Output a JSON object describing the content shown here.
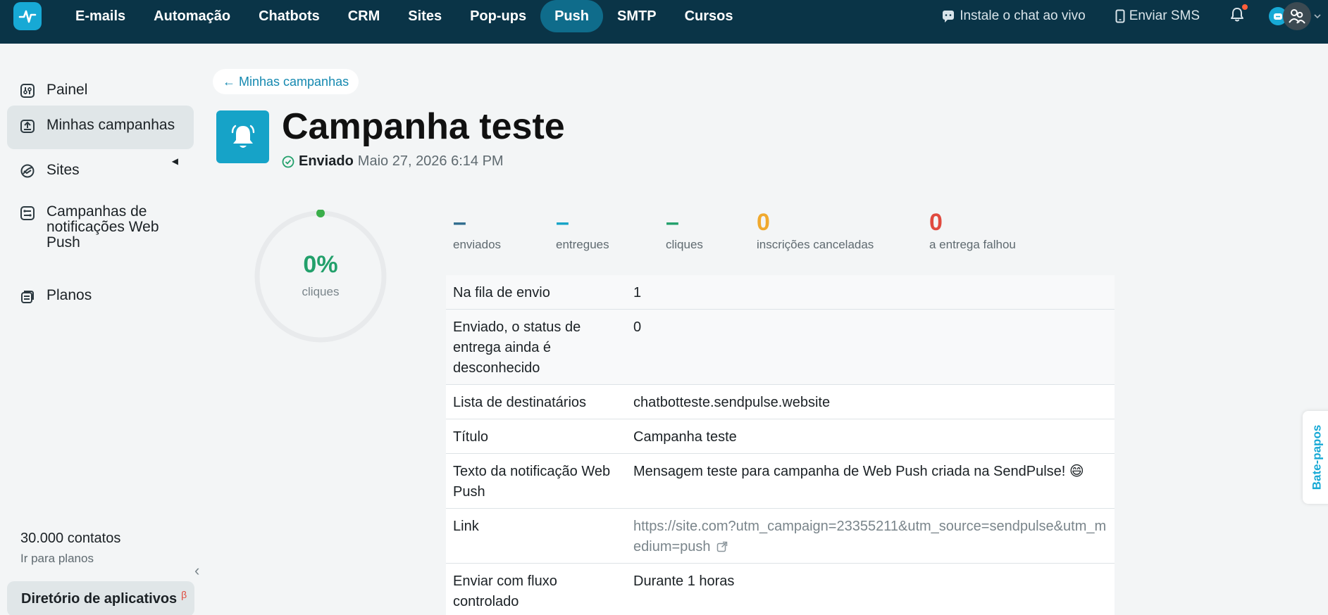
{
  "topbar": {
    "nav": [
      "E-mails",
      "Automação",
      "Chatbots",
      "CRM",
      "Sites",
      "Pop-ups",
      "Push",
      "SMTP",
      "Cursos"
    ],
    "active": "Push",
    "live_chat": "Instale o chat ao vivo",
    "sms": "Enviar SMS"
  },
  "sidebar": {
    "items": [
      {
        "label": "Painel",
        "icon": "dashboard-icon"
      },
      {
        "label": "Minhas campanhas",
        "icon": "campaigns-icon"
      },
      {
        "label": "Sites",
        "icon": "sites-icon"
      },
      {
        "label": "Campanhas de notificações Web Push",
        "icon": "webpush-campaigns-icon"
      },
      {
        "label": "Planos",
        "icon": "plans-icon"
      }
    ],
    "contacts": "30.000 contatos",
    "plans_link": "Ir para planos",
    "app_directory": "Diretório de aplicativos",
    "beta": "β"
  },
  "main": {
    "back": "← Minhas campanhas",
    "title": "Campanha teste",
    "status": "Enviado",
    "date": "Maio 27, 2026 6:14 PM",
    "ring_value": "0%",
    "ring_label": "cliques",
    "stats": [
      {
        "value": "–",
        "label": "enviados",
        "color": "#2f6c8e"
      },
      {
        "value": "–",
        "label": "entregues",
        "color": "#14a3c7"
      },
      {
        "value": "–",
        "label": "cliques",
        "color": "#22a06b"
      },
      {
        "value": "0",
        "label": "inscrições canceladas",
        "color": "#f0a92e"
      },
      {
        "value": "0",
        "label": "a entrega falhou",
        "color": "#e04a3f"
      }
    ],
    "details": [
      {
        "key": "Na fila de envio",
        "value": "1"
      },
      {
        "key": "Enviado, o status de entrega ainda é desconhecido",
        "value": "0"
      },
      {
        "key": "Lista de destinatários",
        "value": "chatbotteste.sendpulse.website"
      },
      {
        "key": "Título",
        "value": "Campanha teste"
      },
      {
        "key": "Texto da notificação Web Push",
        "value": "Mensagem teste para campanha de Web Push criada na SendPulse! 😄"
      },
      {
        "key": "Link",
        "value": "https://site.com?utm_campaign=23355211&utm_source=sendpulse&utm_medium=push"
      },
      {
        "key": "Enviar com fluxo controlado",
        "value": "Durante 1 horas"
      }
    ]
  },
  "chat_tab": "Bate-papos"
}
